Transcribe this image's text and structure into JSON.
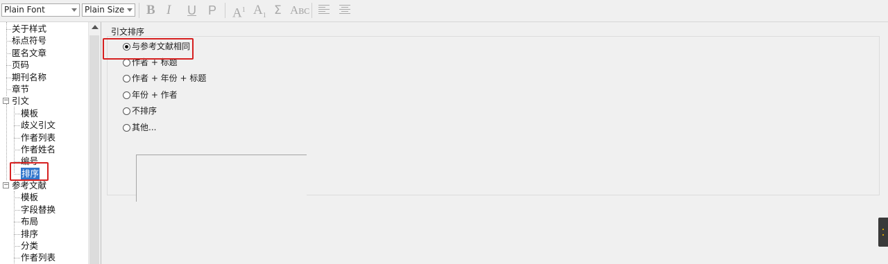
{
  "toolbar": {
    "font_value": "Plain Font",
    "size_value": "Plain Size",
    "bold": "B",
    "italic": "I",
    "underline": "U",
    "plain": "P",
    "superscript_base": "A",
    "superscript_mark": "1",
    "subscript_base": "A",
    "subscript_mark": "1",
    "symbol": "Σ",
    "small_caps": "Aʙᴄ"
  },
  "tree": {
    "items": [
      {
        "label": "关于样式",
        "level": 0
      },
      {
        "label": "标点符号",
        "level": 0
      },
      {
        "label": "匿名文章",
        "level": 0
      },
      {
        "label": "页码",
        "level": 0
      },
      {
        "label": "期刊名称",
        "level": 0
      },
      {
        "label": "章节",
        "level": 0
      },
      {
        "label": "引文",
        "level": 0,
        "expander": "⊟"
      },
      {
        "label": "模板",
        "level": 1
      },
      {
        "label": "歧义引文",
        "level": 1
      },
      {
        "label": "作者列表",
        "level": 1
      },
      {
        "label": "作者姓名",
        "level": 1
      },
      {
        "label": "编号",
        "level": 1
      },
      {
        "label": "排序",
        "level": 1,
        "selected": true
      },
      {
        "label": "参考文献",
        "level": 0,
        "expander": "⊟"
      },
      {
        "label": "模板",
        "level": 1
      },
      {
        "label": "字段替换",
        "level": 1
      },
      {
        "label": "布局",
        "level": 1
      },
      {
        "label": "排序",
        "level": 1
      },
      {
        "label": "分类",
        "level": 1
      },
      {
        "label": "作者列表",
        "level": 1
      }
    ]
  },
  "panel": {
    "group_title": "引文排序",
    "options": [
      {
        "label": "与参考文献相同",
        "checked": true
      },
      {
        "label": "作者 + 标题",
        "checked": false
      },
      {
        "label": "作者 + 年份 + 标题",
        "checked": false
      },
      {
        "label": "年份 + 作者",
        "checked": false
      },
      {
        "label": "不排序",
        "checked": false
      },
      {
        "label": "其他...",
        "checked": false
      }
    ]
  },
  "colors": {
    "selection": "#3277cc",
    "annotation_red": "#d62020"
  }
}
